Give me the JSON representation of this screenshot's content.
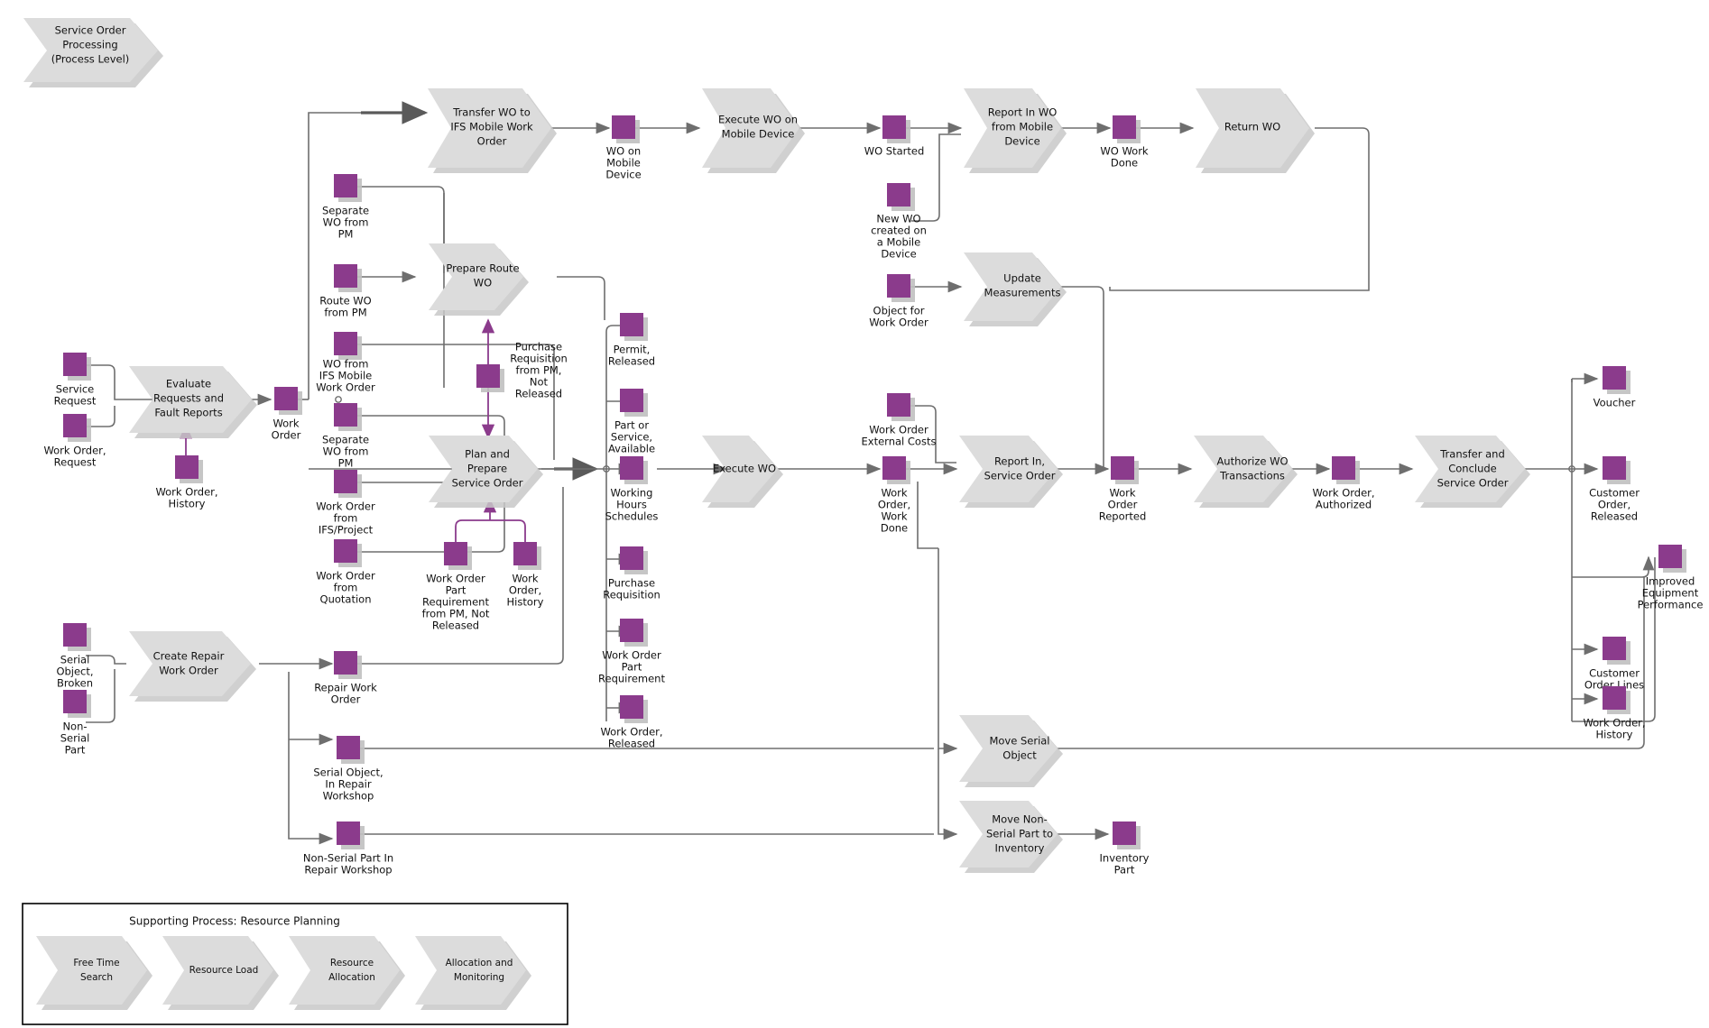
{
  "diagram": {
    "title": "Service Order Processing (Process Level)",
    "colors": {
      "process_fill": "#dcdcdc",
      "store_fill": "#8b3b8c",
      "connector": "#6e6e6e",
      "purple_connector": "#8b3b8c",
      "background": "#ffffff"
    },
    "header": {
      "label": "Service Order\nProcessing\n(Process Level)",
      "line1": "Service Order",
      "line2": "Processing",
      "line3": "(Process Level)"
    },
    "processes": [
      {
        "id": "transfer-wo-mobile",
        "lines": [
          "Transfer WO to",
          "IFS Mobile Work",
          "Order"
        ]
      },
      {
        "id": "execute-wo-mobile",
        "lines": [
          "Execute WO on",
          "Mobile Device"
        ]
      },
      {
        "id": "report-in-wo-mobile",
        "lines": [
          "Report In WO",
          "from Mobile",
          "Device"
        ]
      },
      {
        "id": "return-wo",
        "lines": [
          "Return WO"
        ]
      },
      {
        "id": "prepare-route-wo",
        "lines": [
          "Prepare Route",
          "WO"
        ]
      },
      {
        "id": "update-measurements",
        "lines": [
          "Update",
          "Measurements"
        ]
      },
      {
        "id": "evaluate-requests",
        "lines": [
          "Evaluate",
          "Requests and",
          "Fault Reports"
        ]
      },
      {
        "id": "plan-prepare-service-order",
        "lines": [
          "Plan and",
          "Prepare",
          "Service Order"
        ]
      },
      {
        "id": "execute-wo",
        "lines": [
          "Execute WO"
        ]
      },
      {
        "id": "report-in-service-order",
        "lines": [
          "Report In,",
          "Service Order"
        ]
      },
      {
        "id": "authorize-wo-transactions",
        "lines": [
          "Authorize WO",
          "Transactions"
        ]
      },
      {
        "id": "transfer-conclude-service-order",
        "lines": [
          "Transfer and",
          "Conclude",
          "Service Order"
        ]
      },
      {
        "id": "create-repair-work-order",
        "lines": [
          "Create Repair",
          "Work Order"
        ]
      },
      {
        "id": "move-serial-object",
        "lines": [
          "Move Serial",
          "Object"
        ]
      },
      {
        "id": "move-non-serial-part",
        "lines": [
          "Move Non-",
          "Serial Part to",
          "Inventory"
        ]
      }
    ],
    "stores": [
      {
        "id": "wo-on-mobile-device",
        "lines": [
          "WO on",
          "Mobile",
          "Device"
        ]
      },
      {
        "id": "wo-started",
        "lines": [
          "WO Started"
        ]
      },
      {
        "id": "wo-work-done",
        "lines": [
          "WO Work",
          "Done"
        ]
      },
      {
        "id": "new-wo-created-mobile",
        "lines": [
          "New WO",
          "created on",
          "a Mobile",
          "Device"
        ]
      },
      {
        "id": "object-for-work-order",
        "lines": [
          "Object for",
          "Work Order"
        ]
      },
      {
        "id": "separate-wo-from-pm-1",
        "lines": [
          "Separate",
          "WO from",
          "PM"
        ]
      },
      {
        "id": "route-wo-from-pm",
        "lines": [
          "Route WO",
          "from PM"
        ]
      },
      {
        "id": "wo-from-ifs-mobile-work-order",
        "lines": [
          "WO from",
          "IFS Mobile",
          "Work Order"
        ]
      },
      {
        "id": "separate-wo-from-pm-2",
        "lines": [
          "Separate",
          "WO from",
          "PM"
        ]
      },
      {
        "id": "work-order-from-ifs-project",
        "lines": [
          "Work Order",
          "from",
          "IFS/Project"
        ]
      },
      {
        "id": "work-order-from-quotation",
        "lines": [
          "Work Order",
          "from",
          "Quotation"
        ]
      },
      {
        "id": "repair-work-order",
        "lines": [
          "Repair Work",
          "Order"
        ]
      },
      {
        "id": "service-request",
        "lines": [
          "Service",
          "Request"
        ]
      },
      {
        "id": "work-order-request",
        "lines": [
          "Work Order,",
          "Request"
        ]
      },
      {
        "id": "work-order-history-left",
        "lines": [
          "Work Order,",
          "History"
        ]
      },
      {
        "id": "work-order",
        "lines": [
          "Work",
          "Order"
        ]
      },
      {
        "id": "purchase-requisition-from-pm-not-released",
        "lines": [
          "Purchase",
          "Requisition",
          "from PM,",
          "Not",
          "Released"
        ]
      },
      {
        "id": "work-order-part-requirement-from-pm-not-released",
        "lines": [
          "Work Order",
          "Part",
          "Requirement",
          "from PM, Not",
          "Released"
        ]
      },
      {
        "id": "work-order-history-mid",
        "lines": [
          "Work",
          "Order,",
          "History"
        ]
      },
      {
        "id": "permit-released",
        "lines": [
          "Permit,",
          "Released"
        ]
      },
      {
        "id": "part-or-service-available",
        "lines": [
          "Part or",
          "Service,",
          "Available"
        ]
      },
      {
        "id": "working-hours-schedules",
        "lines": [
          "Working",
          "Hours",
          "Schedules"
        ]
      },
      {
        "id": "purchase-requisition",
        "lines": [
          "Purchase",
          "Requisition"
        ]
      },
      {
        "id": "work-order-part-requirement",
        "lines": [
          "Work Order",
          "Part",
          "Requirement"
        ]
      },
      {
        "id": "work-order-released",
        "lines": [
          "Work Order,",
          "Released"
        ]
      },
      {
        "id": "work-order-external-costs",
        "lines": [
          "Work Order",
          "External Costs"
        ]
      },
      {
        "id": "work-order-work-done",
        "lines": [
          "Work",
          "Order,",
          "Work",
          "Done"
        ]
      },
      {
        "id": "work-order-reported",
        "lines": [
          "Work",
          "Order",
          "Reported"
        ]
      },
      {
        "id": "work-order-authorized",
        "lines": [
          "Work Order,",
          "Authorized"
        ]
      },
      {
        "id": "voucher",
        "lines": [
          "Voucher"
        ]
      },
      {
        "id": "customer-order-released",
        "lines": [
          "Customer",
          "Order,",
          "Released"
        ]
      },
      {
        "id": "customer-order-lines",
        "lines": [
          "Customer",
          "Order Lines"
        ]
      },
      {
        "id": "work-order-history-right",
        "lines": [
          "Work Order,",
          "History"
        ]
      },
      {
        "id": "improved-equipment-performance",
        "lines": [
          "Improved",
          "Equipment",
          "Performance"
        ]
      },
      {
        "id": "serial-object-broken",
        "lines": [
          "Serial",
          "Object,",
          "Broken"
        ]
      },
      {
        "id": "non-serial-part",
        "lines": [
          "Non-",
          "Serial",
          "Part"
        ]
      },
      {
        "id": "serial-object-in-repair-workshop",
        "lines": [
          "Serial Object,",
          "In Repair",
          "Workshop"
        ]
      },
      {
        "id": "non-serial-part-in-repair-workshop",
        "lines": [
          "Non-Serial Part In",
          "Repair Workshop"
        ]
      },
      {
        "id": "inventory-part",
        "lines": [
          "Inventory",
          "Part"
        ]
      }
    ],
    "supporting_process": {
      "title": "Supporting Process: Resource Planning",
      "steps": [
        {
          "id": "free-time-search",
          "lines": [
            "Free Time",
            "Search"
          ]
        },
        {
          "id": "resource-load",
          "lines": [
            "Resource Load"
          ]
        },
        {
          "id": "resource-allocation",
          "lines": [
            "Resource",
            "Allocation"
          ]
        },
        {
          "id": "allocation-and-monitoring",
          "lines": [
            "Allocation and",
            "Monitoring"
          ]
        }
      ]
    }
  }
}
